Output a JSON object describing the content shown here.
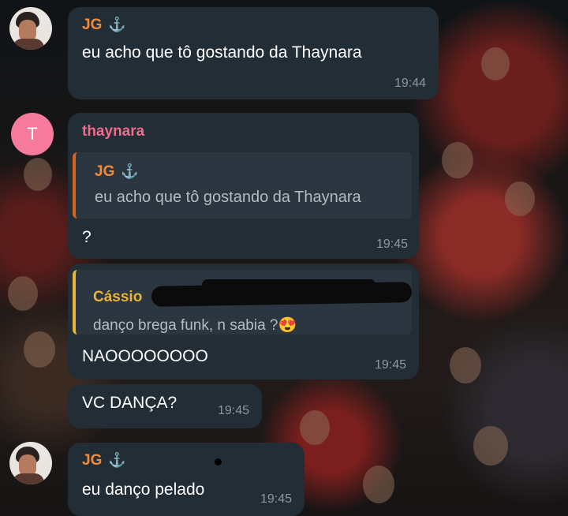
{
  "colors": {
    "bubble": "#222d36",
    "jg_name": "#f08b3c",
    "thaynara_name": "#f06b8c",
    "cassio_name": "#e8b43a",
    "timestamp": "#8b98a3",
    "reply_bar_orange": "#d6651e",
    "reply_bar_yellow": "#e8b43a"
  },
  "messages": {
    "m1": {
      "author": "JG",
      "anchor": "⚓",
      "text": "eu acho que tô gostando da Thaynara",
      "time": "19:44"
    },
    "m2": {
      "author": "thaynara",
      "avatar_letter": "T",
      "reply_author": "JG",
      "reply_anchor": "⚓",
      "reply_text": "eu acho que tô gostando da Thaynara",
      "text": "?",
      "time": "19:45"
    },
    "m3": {
      "reply_author": "Cássio",
      "reply_text": "danço brega funk, n sabia ?😍",
      "text": "NAOOOOOOOO",
      "time": "19:45"
    },
    "m4": {
      "text": "VC DANÇA?",
      "time": "19:45"
    },
    "m5": {
      "author": "JG",
      "anchor": "⚓",
      "text": "eu danço pelado",
      "time": "19:45"
    }
  }
}
